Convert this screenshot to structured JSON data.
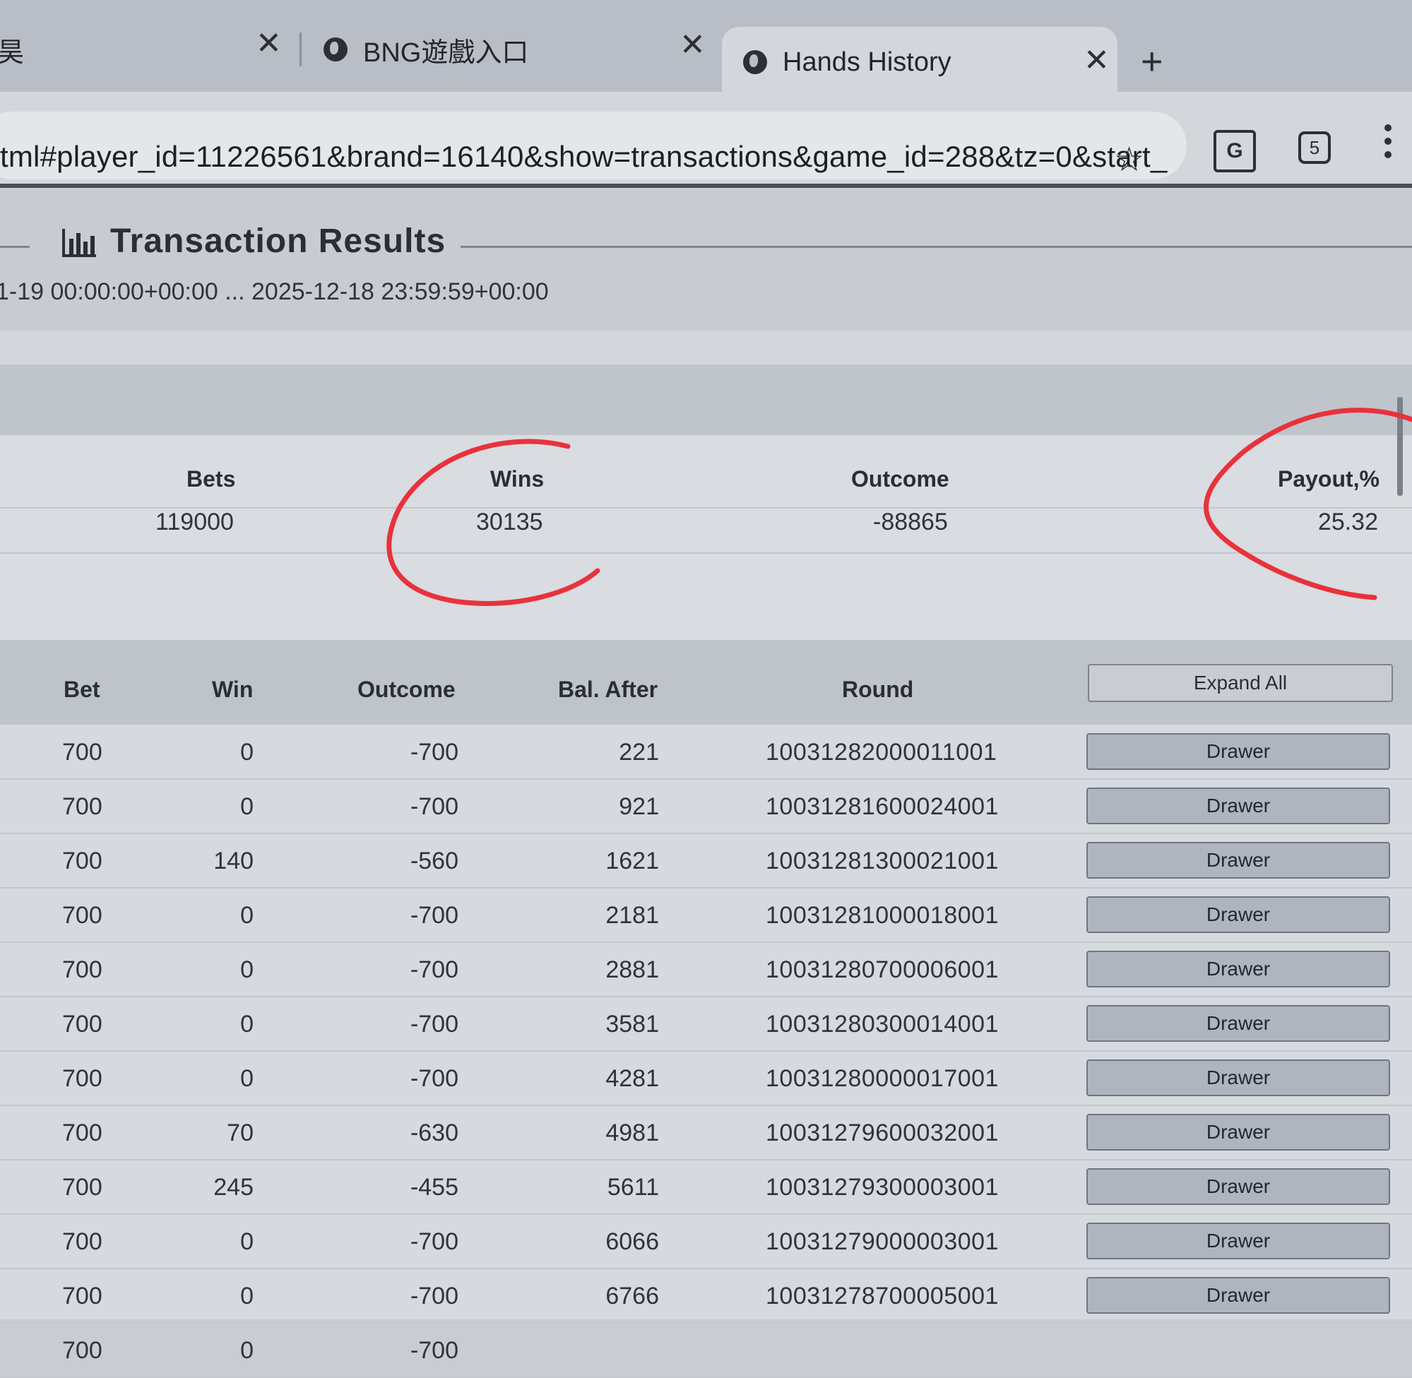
{
  "browser": {
    "tabs": [
      {
        "label": "昊",
        "active": false
      },
      {
        "label": "BNG遊戲入口",
        "active": false
      },
      {
        "label": "Hands History",
        "active": true
      }
    ],
    "url": "tml#player_id=11226561&brand=16140&show=transactions&game_id=288&tz=0&start_",
    "tab_count": "5",
    "icons": [
      "globe-icon",
      "close-icon",
      "new-tab-icon",
      "star-icon",
      "translate-icon",
      "tab-count-icon",
      "menu-icon"
    ]
  },
  "page": {
    "title": "Transaction Results",
    "date_range": "1-19 00:00:00+00:00 ... 2025-12-18 23:59:59+00:00"
  },
  "summary": {
    "headers": {
      "bets": "Bets",
      "wins": "Wins",
      "outcome": "Outcome",
      "payout": "Payout,%"
    },
    "values": {
      "bets": "119000",
      "wins": "30135",
      "outcome": "-88865",
      "payout": "25.32"
    }
  },
  "table": {
    "headers": {
      "bet": "Bet",
      "win": "Win",
      "outcome": "Outcome",
      "bal_after": "Bal. After",
      "round": "Round"
    },
    "expand_all_label": "Expand All",
    "drawer_label": "Drawer",
    "rows": [
      {
        "bet": "700",
        "win": "0",
        "outcome": "-700",
        "bal_after": "221",
        "round": "10031282000011001"
      },
      {
        "bet": "700",
        "win": "0",
        "outcome": "-700",
        "bal_after": "921",
        "round": "10031281600024001"
      },
      {
        "bet": "700",
        "win": "140",
        "outcome": "-560",
        "bal_after": "1621",
        "round": "10031281300021001"
      },
      {
        "bet": "700",
        "win": "0",
        "outcome": "-700",
        "bal_after": "2181",
        "round": "10031281000018001"
      },
      {
        "bet": "700",
        "win": "0",
        "outcome": "-700",
        "bal_after": "2881",
        "round": "10031280700006001"
      },
      {
        "bet": "700",
        "win": "0",
        "outcome": "-700",
        "bal_after": "3581",
        "round": "10031280300014001"
      },
      {
        "bet": "700",
        "win": "0",
        "outcome": "-700",
        "bal_after": "4281",
        "round": "10031280000017001"
      },
      {
        "bet": "700",
        "win": "70",
        "outcome": "-630",
        "bal_after": "4981",
        "round": "10031279600032001"
      },
      {
        "bet": "700",
        "win": "245",
        "outcome": "-455",
        "bal_after": "5611",
        "round": "10031279300003001"
      },
      {
        "bet": "700",
        "win": "0",
        "outcome": "-700",
        "bal_after": "6066",
        "round": "10031279000003001"
      },
      {
        "bet": "700",
        "win": "0",
        "outcome": "-700",
        "bal_after": "6766",
        "round": "10031278700005001"
      },
      {
        "bet": "700",
        "win": "0",
        "outcome": "-700",
        "bal_after": "",
        "round": ""
      }
    ]
  },
  "colors": {
    "annotation_red": "#e8323c",
    "page_bg": "#c8ccd2",
    "table_row_bg": "#d6d9de"
  }
}
